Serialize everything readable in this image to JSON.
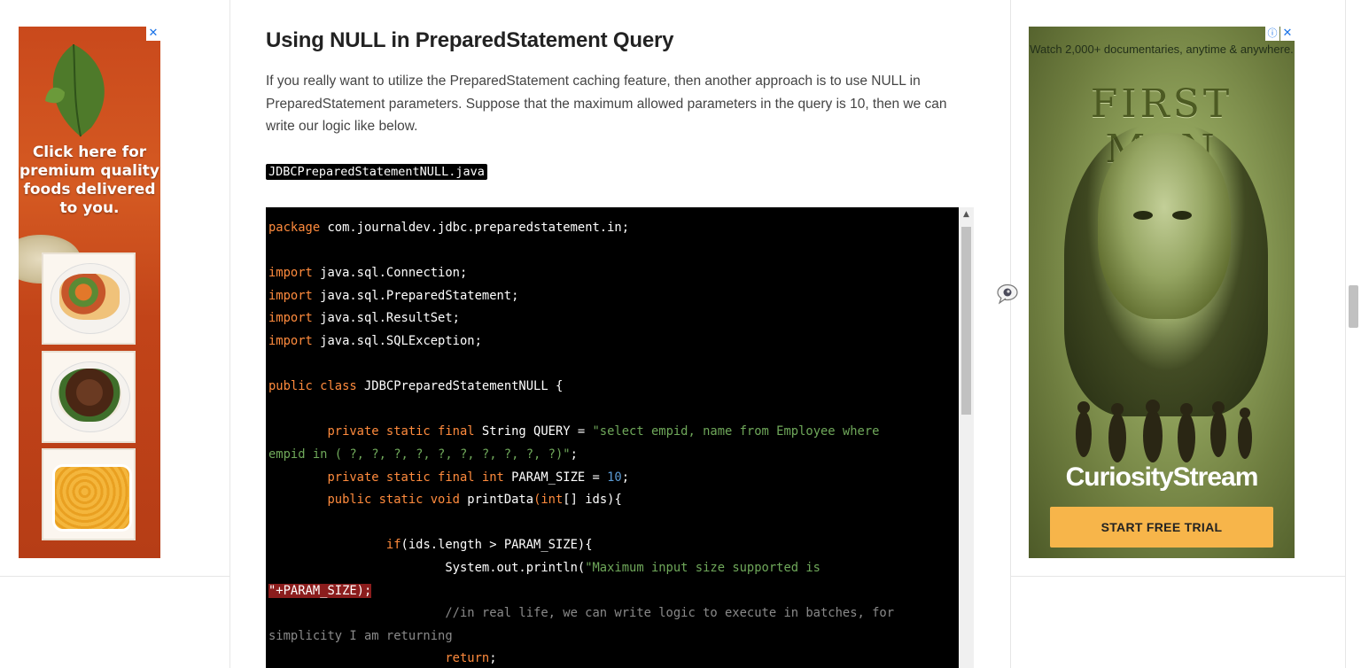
{
  "article": {
    "heading": "Using NULL in PreparedStatement Query",
    "paragraph": "If you really want to utilize the PreparedStatement caching feature, then another approach is to use NULL in PreparedStatement parameters. Suppose that the maximum allowed parameters in the query is 10, then we can write our logic like below.",
    "filename": "JDBCPreparedStatementNULL.java"
  },
  "code_lines": [
    {
      "segments": [
        {
          "t": "package",
          "c": "kw"
        },
        {
          "t": " com.journaldev.jdbc.preparedstatement.in;",
          "c": ""
        }
      ]
    },
    {
      "segments": []
    },
    {
      "segments": [
        {
          "t": "import",
          "c": "kw"
        },
        {
          "t": " java.sql.Connection;",
          "c": ""
        }
      ]
    },
    {
      "segments": [
        {
          "t": "import",
          "c": "kw"
        },
        {
          "t": " java.sql.PreparedStatement;",
          "c": ""
        }
      ]
    },
    {
      "segments": [
        {
          "t": "import",
          "c": "kw"
        },
        {
          "t": " java.sql.ResultSet;",
          "c": ""
        }
      ]
    },
    {
      "segments": [
        {
          "t": "import",
          "c": "kw"
        },
        {
          "t": " java.sql.SQLException;",
          "c": ""
        }
      ]
    },
    {
      "segments": []
    },
    {
      "segments": [
        {
          "t": "public class",
          "c": "kw"
        },
        {
          "t": " JDBCPreparedStatementNULL {",
          "c": ""
        }
      ]
    },
    {
      "segments": []
    },
    {
      "segments": [
        {
          "t": "        ",
          "c": ""
        },
        {
          "t": "private static final",
          "c": "kw"
        },
        {
          "t": " String QUERY = ",
          "c": ""
        },
        {
          "t": "\"select empid, name from Employee where",
          "c": "str"
        }
      ]
    },
    {
      "segments": [
        {
          "t": "empid in ( ?, ?, ?, ?, ?, ?, ?, ?, ?, ?)\"",
          "c": "str"
        },
        {
          "t": ";",
          "c": ""
        }
      ]
    },
    {
      "segments": [
        {
          "t": "        ",
          "c": ""
        },
        {
          "t": "private static final int",
          "c": "kw"
        },
        {
          "t": " PARAM_SIZE = ",
          "c": ""
        },
        {
          "t": "10",
          "c": "num"
        },
        {
          "t": ";",
          "c": ""
        }
      ]
    },
    {
      "segments": [
        {
          "t": "        ",
          "c": ""
        },
        {
          "t": "public static void",
          "c": "kw"
        },
        {
          "t": " printData",
          "c": ""
        },
        {
          "t": "(int",
          "c": "kw"
        },
        {
          "t": "[] ids){",
          "c": ""
        }
      ]
    },
    {
      "segments": []
    },
    {
      "segments": [
        {
          "t": "                ",
          "c": ""
        },
        {
          "t": "if",
          "c": "kw"
        },
        {
          "t": "(ids.length > PARAM_SIZE){",
          "c": ""
        }
      ]
    },
    {
      "segments": [
        {
          "t": "                        System.out.println(",
          "c": ""
        },
        {
          "t": "\"Maximum input size supported is",
          "c": "str"
        }
      ]
    },
    {
      "segments": [
        {
          "t": "\"+PARAM_SIZE);",
          "c": "hl"
        }
      ]
    },
    {
      "segments": [
        {
          "t": "                        //in real life, we can write logic to execute in batches, for",
          "c": "com"
        }
      ]
    },
    {
      "segments": [
        {
          "t": "simplicity I am returning",
          "c": "com"
        }
      ]
    },
    {
      "segments": [
        {
          "t": "                        ",
          "c": ""
        },
        {
          "t": "return",
          "c": "kw"
        },
        {
          "t": ";",
          "c": ""
        }
      ]
    }
  ],
  "ad_left": {
    "headline": "Click here for premium quality foods delivered to you.",
    "close_label": "✕"
  },
  "ad_right": {
    "tagline": "Watch 2,000+ documentaries, anytime & anywhere.",
    "title": "FIRST MAN",
    "brand": "CuriosityStream",
    "cta": "START FREE TRIAL",
    "close_label": "✕",
    "adchoices_label": "ⓘ"
  },
  "colors": {
    "code_keyword": "#ff8b3d",
    "code_string": "#6fa85a",
    "code_number": "#5b9bd5",
    "code_comment": "#8a8a8a",
    "cta_bg": "#f7b54a"
  },
  "icons": {
    "chat": "chat-bubble-icon",
    "scroll_up": "scroll-up-arrow-icon"
  }
}
